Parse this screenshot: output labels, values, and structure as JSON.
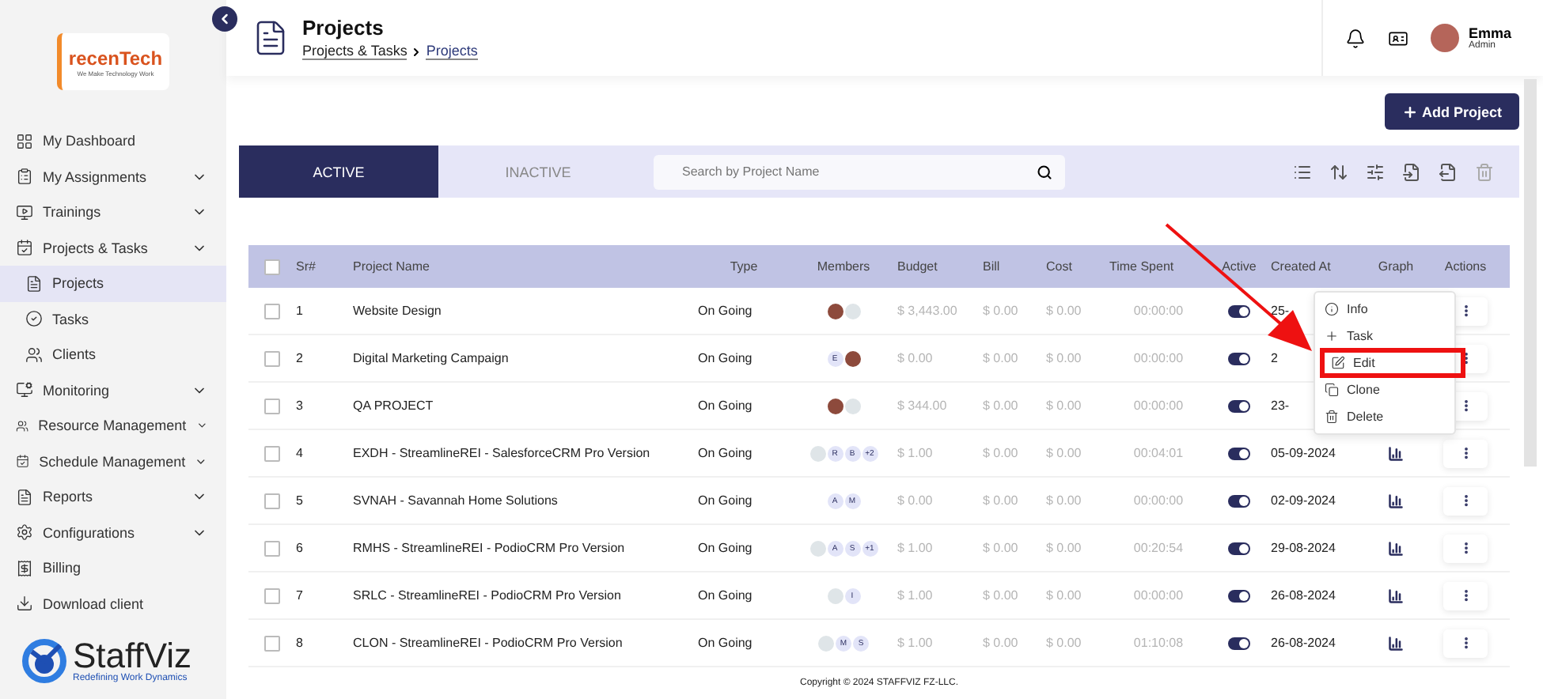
{
  "sidebar": {
    "items": [
      {
        "label": "My Dashboard",
        "expandable": false,
        "selected": false
      },
      {
        "label": "My Assignments",
        "expandable": true,
        "selected": false
      },
      {
        "label": "Trainings",
        "expandable": true,
        "selected": false
      },
      {
        "label": "Projects & Tasks",
        "expandable": true,
        "selected": false,
        "children": [
          {
            "label": "Projects",
            "selected": true
          },
          {
            "label": "Tasks",
            "selected": false
          },
          {
            "label": "Clients",
            "selected": false
          }
        ]
      },
      {
        "label": "Monitoring",
        "expandable": true,
        "selected": false
      },
      {
        "label": "Resource Management",
        "expandable": true,
        "selected": false
      },
      {
        "label": "Schedule Management",
        "expandable": true,
        "selected": false
      },
      {
        "label": "Reports",
        "expandable": true,
        "selected": false
      },
      {
        "label": "Configurations",
        "expandable": true,
        "selected": false
      },
      {
        "label": "Billing",
        "expandable": false,
        "selected": false
      },
      {
        "label": "Download client",
        "expandable": false,
        "selected": false
      }
    ],
    "brand": {
      "name": "StaffViz",
      "tagline": "Redefining Work Dynamics"
    },
    "company": {
      "name": "recenTech",
      "tagline": "We Make Technology Work"
    }
  },
  "header": {
    "title": "Projects",
    "breadcrumb": [
      "Projects & Tasks",
      "Projects"
    ],
    "user": {
      "name": "Emma",
      "role": "Admin"
    }
  },
  "add_button": "Add Project",
  "tabs": [
    {
      "label": "ACTIVE",
      "selected": true
    },
    {
      "label": "INACTIVE",
      "selected": false
    }
  ],
  "search": {
    "placeholder": "Search by Project Name"
  },
  "table": {
    "all_checked": false,
    "columns": [
      "Sr#",
      "Project Name",
      "Type",
      "Members",
      "Budget",
      "Bill",
      "Cost",
      "Time Spent",
      "Active",
      "Created At",
      "Graph",
      "Actions"
    ],
    "rows": [
      {
        "checked": false,
        "sr": "1",
        "name": "Website Design",
        "type": "On Going",
        "members": [
          {
            "kind": "photo"
          },
          {
            "kind": "logo"
          }
        ],
        "budget": "$ 3,443.00",
        "bill": "$ 0.00",
        "cost": "$ 0.00",
        "time": "00:00:00",
        "active": true,
        "created": "25-",
        "graph": false
      },
      {
        "checked": false,
        "sr": "2",
        "name": "Digital Marketing Campaign",
        "type": "On Going",
        "members": [
          {
            "kind": "letter",
            "text": "E"
          },
          {
            "kind": "photo"
          }
        ],
        "budget": "$ 0.00",
        "bill": "$ 0.00",
        "cost": "$ 0.00",
        "time": "00:00:00",
        "active": true,
        "created": "2",
        "graph": false
      },
      {
        "checked": false,
        "sr": "3",
        "name": "QA PROJECT",
        "type": "On Going",
        "members": [
          {
            "kind": "photo"
          },
          {
            "kind": "logo"
          }
        ],
        "budget": "$ 344.00",
        "bill": "$ 0.00",
        "cost": "$ 0.00",
        "time": "00:00:00",
        "active": true,
        "created": "23-",
        "graph": false
      },
      {
        "checked": false,
        "sr": "4",
        "name": "EXDH - StreamlineREI - SalesforceCRM Pro Version",
        "type": "On Going",
        "members": [
          {
            "kind": "logo"
          },
          {
            "kind": "letter",
            "text": "R"
          },
          {
            "kind": "letter",
            "text": "B"
          },
          {
            "kind": "letter",
            "text": "+2"
          }
        ],
        "budget": "$ 1.00",
        "bill": "$ 0.00",
        "cost": "$ 0.00",
        "time": "00:04:01",
        "active": true,
        "created": "05-09-2024",
        "graph": true
      },
      {
        "checked": false,
        "sr": "5",
        "name": "SVNAH - Savannah Home Solutions",
        "type": "On Going",
        "members": [
          {
            "kind": "letter",
            "text": "A"
          },
          {
            "kind": "letter",
            "text": "M"
          }
        ],
        "budget": "$ 0.00",
        "bill": "$ 0.00",
        "cost": "$ 0.00",
        "time": "00:00:00",
        "active": true,
        "created": "02-09-2024",
        "graph": true
      },
      {
        "checked": false,
        "sr": "6",
        "name": "RMHS - StreamlineREI - PodioCRM Pro Version",
        "type": "On Going",
        "members": [
          {
            "kind": "logo"
          },
          {
            "kind": "letter",
            "text": "A"
          },
          {
            "kind": "letter",
            "text": "S"
          },
          {
            "kind": "letter",
            "text": "+1"
          }
        ],
        "budget": "$ 1.00",
        "bill": "$ 0.00",
        "cost": "$ 0.00",
        "time": "00:20:54",
        "active": true,
        "created": "29-08-2024",
        "graph": true
      },
      {
        "checked": false,
        "sr": "7",
        "name": "SRLC - StreamlineREI - PodioCRM Pro Version",
        "type": "On Going",
        "members": [
          {
            "kind": "logo"
          },
          {
            "kind": "letter",
            "text": "I"
          }
        ],
        "budget": "$ 1.00",
        "bill": "$ 0.00",
        "cost": "$ 0.00",
        "time": "00:00:00",
        "active": true,
        "created": "26-08-2024",
        "graph": true
      },
      {
        "checked": false,
        "sr": "8",
        "name": "CLON - StreamlineREI - PodioCRM Pro Version",
        "type": "On Going",
        "members": [
          {
            "kind": "logo"
          },
          {
            "kind": "letter",
            "text": "M"
          },
          {
            "kind": "letter",
            "text": "S"
          }
        ],
        "budget": "$ 1.00",
        "bill": "$ 0.00",
        "cost": "$ 0.00",
        "time": "01:10:08",
        "active": true,
        "created": "26-08-2024",
        "graph": true
      }
    ]
  },
  "action_menu": {
    "items": [
      {
        "label": "Info",
        "highlighted": false
      },
      {
        "label": "Task",
        "highlighted": false
      },
      {
        "label": "Edit",
        "highlighted": true
      },
      {
        "label": "Clone",
        "highlighted": false
      },
      {
        "label": "Delete",
        "highlighted": false
      }
    ]
  },
  "footer": "Copyright © 2024 STAFFVIZ FZ-LLC."
}
